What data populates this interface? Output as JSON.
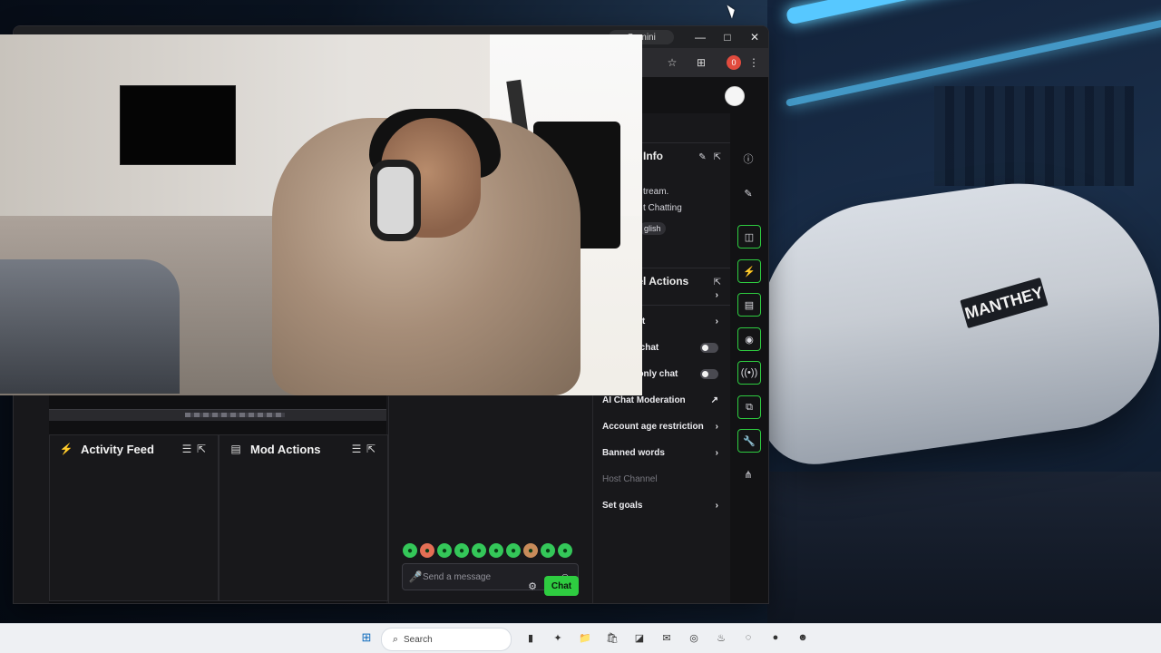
{
  "browser": {
    "profile_label": "Gemini",
    "window_controls": [
      "—",
      "□",
      "✕"
    ],
    "extensions_badge": "0"
  },
  "left_panels": {
    "activity_feed_title": "Activity Feed",
    "mod_actions_title": "Mod Actions"
  },
  "chat": {
    "placeholder": "Send a message",
    "button_label": "Chat"
  },
  "right_panel": {
    "stream_info_title": "Stream Info",
    "stream_text": "tream.",
    "category": "t Chatting",
    "language_badge": "glish",
    "channel_actions_title": "Channel Actions",
    "items": [
      {
        "label": "e",
        "control": "chevron"
      },
      {
        "label": "-only chat",
        "control": "chevron"
      },
      {
        "label": "ers-only chat",
        "control": "toggle"
      },
      {
        "label": "Emotes-only chat",
        "control": "toggle"
      },
      {
        "label": "AI Chat Moderation",
        "control": "external"
      },
      {
        "label": "Account age restriction",
        "control": "chevron"
      },
      {
        "label": "Banned words",
        "control": "chevron"
      },
      {
        "label": "Host Channel",
        "control": "none"
      },
      {
        "label": "Set goals",
        "control": "chevron"
      }
    ]
  },
  "taskbar": {
    "search_text": "Search"
  },
  "background_branding": "MANTHEY"
}
